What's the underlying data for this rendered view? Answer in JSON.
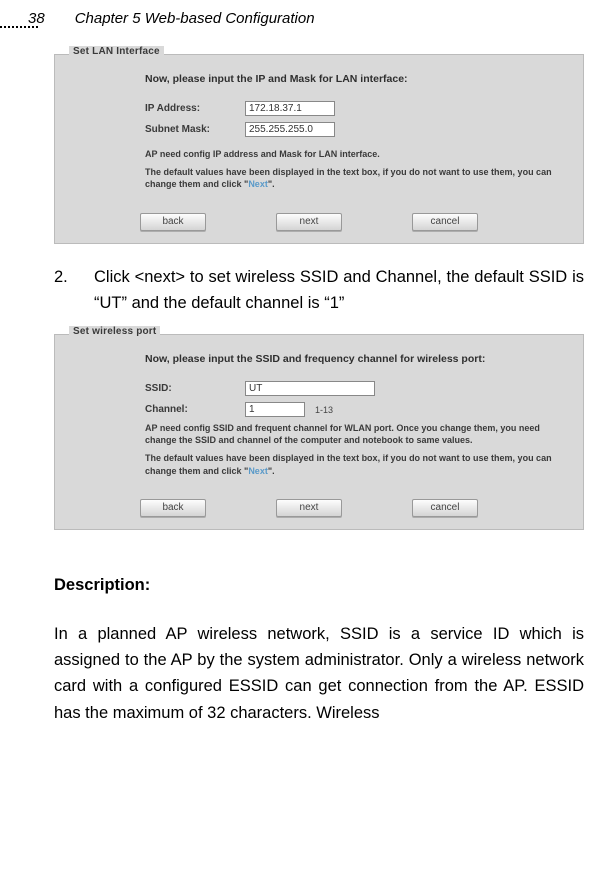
{
  "header": {
    "page_number": "38",
    "chapter": "Chapter 5 Web-based Configuration"
  },
  "panel1": {
    "legend": "Set LAN Interface",
    "instruction": "Now, please input the IP and Mask for LAN interface:",
    "ip_label": "IP Address:",
    "ip_value": "172.18.37.1",
    "mask_label": "Subnet Mask:",
    "mask_value": "255.255.255.0",
    "note": "AP need config IP address and Mask for LAN interface.",
    "hint_part1": "The default values have been displayed in the text box, if you do not want to use them, you can change them and click \"",
    "hint_link": "Next",
    "hint_part2": "\".",
    "btn_back": "back",
    "btn_next": "next",
    "btn_cancel": "cancel"
  },
  "step2": {
    "number": "2.",
    "text": "Click <next> to set wireless SSID and Channel, the default SSID is “UT” and the default channel is “1”"
  },
  "panel2": {
    "legend": "Set wireless port",
    "instruction": "Now, please input the SSID and frequency channel for wireless port:",
    "ssid_label": "SSID:",
    "ssid_value": "UT",
    "channel_label": "Channel:",
    "channel_value": "1",
    "channel_range": "1-13",
    "note": "AP need config SSID and frequent channel for WLAN port. Once you change them, you need change the SSID and channel of the computer and notebook to same values.",
    "hint_part1": "The default values have been displayed in the text box, if you do not want to use them, you can change them and click \"",
    "hint_link": "Next",
    "hint_part2": "\".",
    "btn_back": "back",
    "btn_next": "next",
    "btn_cancel": "cancel"
  },
  "description": {
    "heading": "Description:",
    "paragraph": "In a planned AP wireless network, SSID is a service ID which is assigned to the AP by the system administrator. Only a wireless network card with a configured ESSID can get connection from the AP. ESSID has the maximum of 32 characters. Wireless"
  }
}
